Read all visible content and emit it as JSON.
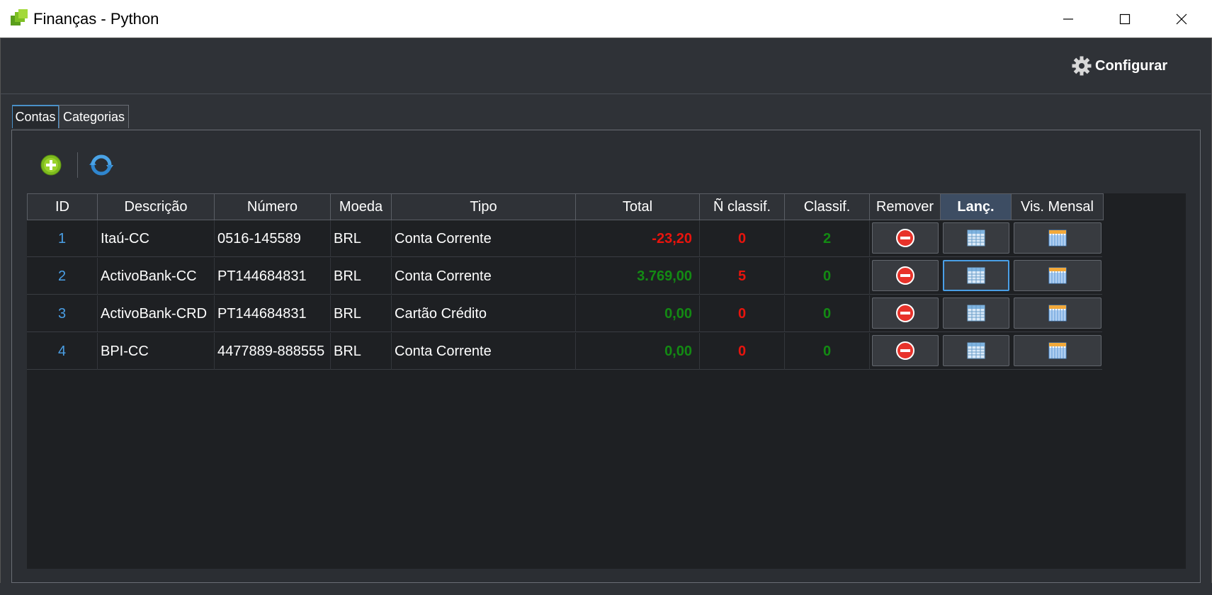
{
  "window": {
    "title": "Finanças - Python"
  },
  "toolbar": {
    "configure_label": "Configurar"
  },
  "tabs": [
    {
      "label": "Contas"
    },
    {
      "label": "Categorias"
    }
  ],
  "table": {
    "headers": [
      "ID",
      "Descrição",
      "Número",
      "Moeda",
      "Tipo",
      "Total",
      "Ñ classif.",
      "Classif.",
      "Remover",
      "Lanç.",
      "Vis. Mensal"
    ],
    "rows": [
      {
        "id": "1",
        "descricao": "Itaú-CC",
        "numero": "0516-145589",
        "moeda": "BRL",
        "tipo": "Conta Corrente",
        "total": "-23,20",
        "nclassif": "0",
        "classif": "2"
      },
      {
        "id": "2",
        "descricao": "ActivoBank-CC",
        "numero": "PT144684831",
        "moeda": "BRL",
        "tipo": "Conta Corrente",
        "total": "3.769,00",
        "nclassif": "5",
        "classif": "0"
      },
      {
        "id": "3",
        "descricao": "ActivoBank-CRD",
        "numero": "PT144684831",
        "moeda": "BRL",
        "tipo": "Cartão Crédito",
        "total": "0,00",
        "nclassif": "0",
        "classif": "0"
      },
      {
        "id": "4",
        "descricao": "BPI-CC",
        "numero": "4477889-888555",
        "moeda": "BRL",
        "tipo": "Conta Corrente",
        "total": "0,00",
        "nclassif": "0",
        "classif": "0"
      }
    ]
  },
  "colors": {
    "negative": "#e8140d",
    "positive": "#138a13",
    "accent": "#4a9fe6"
  },
  "icons": {
    "app": "app-logo-icon",
    "settings": "gear-icon",
    "add": "add-circle-icon",
    "refresh": "refresh-icon",
    "remove": "remove-icon",
    "entries": "grid-table-icon",
    "monthly": "calendar-icon"
  }
}
